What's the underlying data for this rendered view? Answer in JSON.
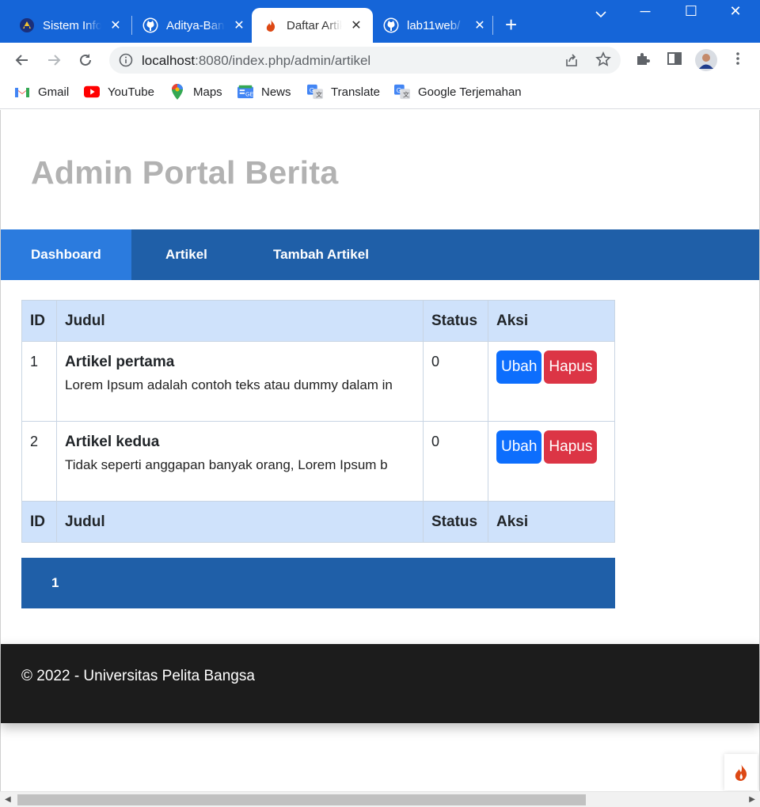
{
  "browser": {
    "tabs": [
      {
        "title": "Sistem Informasi",
        "icon": "university-logo-icon",
        "active": false
      },
      {
        "title": "Aditya-Bangsa",
        "icon": "github-icon",
        "active": false
      },
      {
        "title": "Daftar Artikel",
        "icon": "codeigniter-icon",
        "active": true
      },
      {
        "title": "lab11web/",
        "icon": "github-icon",
        "active": false
      }
    ],
    "url_host": "localhost",
    "url_path": ":8080/index.php/admin/artikel",
    "bookmarks": [
      {
        "label": "Gmail",
        "icon": "gmail-icon"
      },
      {
        "label": "YouTube",
        "icon": "youtube-icon"
      },
      {
        "label": "Maps",
        "icon": "maps-icon"
      },
      {
        "label": "News",
        "icon": "news-icon"
      },
      {
        "label": "Translate",
        "icon": "translate-icon"
      },
      {
        "label": "Google Terjemahan",
        "icon": "translate-icon"
      }
    ]
  },
  "page": {
    "site_title": "Admin Portal Berita",
    "nav": [
      {
        "label": "Dashboard",
        "active": true
      },
      {
        "label": "Artikel",
        "active": false
      },
      {
        "label": "Tambah Artikel",
        "active": false
      }
    ],
    "table": {
      "headers": [
        "ID",
        "Judul",
        "Status",
        "Aksi"
      ],
      "rows": [
        {
          "id": "1",
          "title": "Artikel pertama",
          "excerpt": "Lorem Ipsum adalah contoh teks atau dummy dalam in",
          "status": "0"
        },
        {
          "id": "2",
          "title": "Artikel kedua",
          "excerpt": "Tidak seperti anggapan banyak orang, Lorem Ipsum b",
          "status": "0"
        }
      ],
      "edit_label": "Ubah",
      "delete_label": "Hapus"
    },
    "pagination": {
      "current": "1"
    },
    "footer": "© 2022 - Universitas Pelita Bangsa"
  },
  "colors": {
    "chrome_blue": "#1565d8",
    "nav_blue": "#1f5fa8",
    "nav_active": "#2b7bde",
    "table_header": "#cfe2fb",
    "btn_edit": "#0d6efd",
    "btn_delete": "#dc3545",
    "footer_bg": "#1c1c1c"
  }
}
